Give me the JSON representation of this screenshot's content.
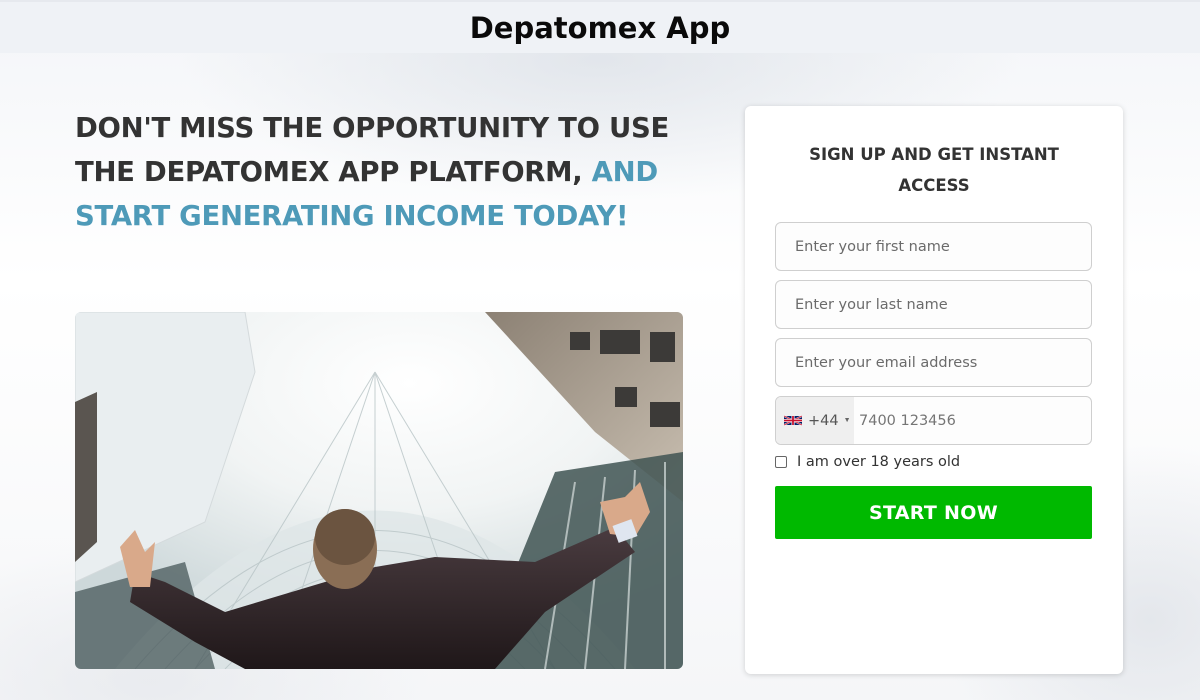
{
  "header": {
    "title": "Depatomex App"
  },
  "headline": {
    "part_dark": "DON'T MISS THE OPPORTUNITY TO USE THE DEPATOMEX APP PLATFORM, ",
    "part_accent": "AND START GENERATING INCOME TODAY!"
  },
  "hero": {
    "alt": "Businessman in suit with arms raised looking up at skyscrapers"
  },
  "form": {
    "title": "SIGN UP AND GET INSTANT ACCESS",
    "first_name": {
      "placeholder": "Enter your first name",
      "value": ""
    },
    "last_name": {
      "placeholder": "Enter your last name",
      "value": ""
    },
    "email": {
      "placeholder": "Enter your email address",
      "value": ""
    },
    "phone": {
      "country_flag": "uk-flag-icon",
      "dial_code": "+44",
      "placeholder": "7400 123456",
      "value": ""
    },
    "age_checkbox": {
      "label": "I am over 18 years old",
      "checked": false
    },
    "submit_label": "START NOW"
  },
  "colors": {
    "accent": "#4e9ab8",
    "headline": "#333333",
    "cta": "#00b900",
    "header_bg": "#eff2f6"
  }
}
